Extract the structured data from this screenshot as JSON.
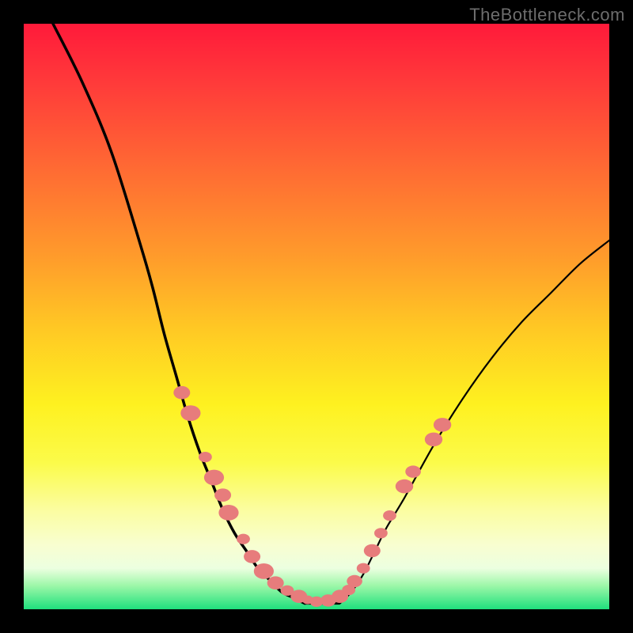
{
  "watermark": "TheBottleneck.com",
  "chart_data": {
    "type": "line",
    "title": "",
    "xlabel": "",
    "ylabel": "",
    "xlim": [
      0,
      100
    ],
    "ylim": [
      0,
      100
    ],
    "grid": false,
    "legend": false,
    "series": [
      {
        "name": "left-curve",
        "x": [
          5,
          10,
          15,
          20,
          22,
          24,
          26,
          28,
          30,
          32,
          34,
          36,
          38,
          40,
          42,
          44,
          46,
          48
        ],
        "y": [
          100,
          90,
          78,
          62,
          55,
          47,
          40,
          33,
          27,
          22,
          17,
          13,
          10,
          7,
          5,
          3,
          2,
          1
        ]
      },
      {
        "name": "valley-floor",
        "x": [
          48,
          50,
          52,
          54
        ],
        "y": [
          1,
          1,
          1,
          1
        ]
      },
      {
        "name": "right-curve",
        "x": [
          54,
          56,
          58,
          60,
          62,
          65,
          70,
          75,
          80,
          85,
          90,
          95,
          100
        ],
        "y": [
          1,
          3,
          6,
          10,
          14,
          19,
          28,
          36,
          43,
          49,
          54,
          59,
          63
        ]
      }
    ],
    "markers": [
      {
        "x": 27.0,
        "y": 37.0,
        "r": 1.5
      },
      {
        "x": 28.5,
        "y": 33.5,
        "r": 1.8
      },
      {
        "x": 31.0,
        "y": 26.0,
        "r": 1.2
      },
      {
        "x": 32.5,
        "y": 22.5,
        "r": 1.8
      },
      {
        "x": 34.0,
        "y": 19.5,
        "r": 1.5
      },
      {
        "x": 35.0,
        "y": 16.5,
        "r": 1.8
      },
      {
        "x": 37.5,
        "y": 12.0,
        "r": 1.2
      },
      {
        "x": 39.0,
        "y": 9.0,
        "r": 1.5
      },
      {
        "x": 41.0,
        "y": 6.5,
        "r": 1.8
      },
      {
        "x": 43.0,
        "y": 4.5,
        "r": 1.5
      },
      {
        "x": 45.0,
        "y": 3.2,
        "r": 1.2
      },
      {
        "x": 47.0,
        "y": 2.2,
        "r": 1.5
      },
      {
        "x": 48.5,
        "y": 1.6,
        "r": 1.0
      },
      {
        "x": 50.0,
        "y": 1.3,
        "r": 1.2
      },
      {
        "x": 52.0,
        "y": 1.5,
        "r": 1.4
      },
      {
        "x": 54.0,
        "y": 2.2,
        "r": 1.5
      },
      {
        "x": 55.5,
        "y": 3.3,
        "r": 1.2
      },
      {
        "x": 56.5,
        "y": 4.8,
        "r": 1.4
      },
      {
        "x": 58.0,
        "y": 7.0,
        "r": 1.2
      },
      {
        "x": 59.5,
        "y": 10.0,
        "r": 1.5
      },
      {
        "x": 61.0,
        "y": 13.0,
        "r": 1.2
      },
      {
        "x": 62.5,
        "y": 16.0,
        "r": 1.2
      },
      {
        "x": 65.0,
        "y": 21.0,
        "r": 1.6
      },
      {
        "x": 66.5,
        "y": 23.5,
        "r": 1.4
      },
      {
        "x": 70.0,
        "y": 29.0,
        "r": 1.6
      },
      {
        "x": 71.5,
        "y": 31.5,
        "r": 1.6
      }
    ],
    "marker_style": {
      "fill": "#e77c7c",
      "stroke": "none"
    },
    "curve_style": {
      "stroke": "#000000",
      "width_left": 3.5,
      "width_right": 2.2
    }
  }
}
